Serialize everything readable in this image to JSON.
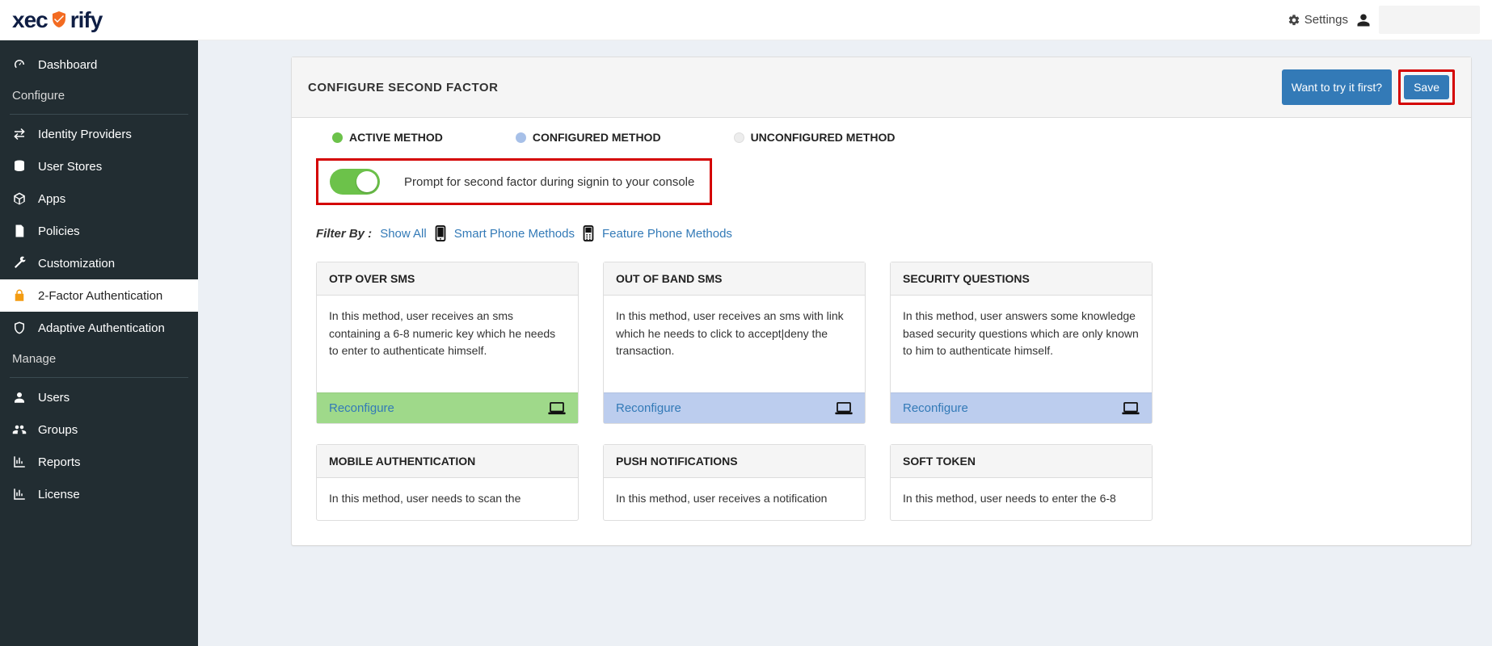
{
  "header": {
    "brand_pre": "xec",
    "brand_post": "rify",
    "settings_label": "Settings"
  },
  "sidebar": {
    "items": [
      {
        "label": "Dashboard"
      },
      {
        "section": "Configure"
      },
      {
        "label": "Identity Providers"
      },
      {
        "label": "User Stores"
      },
      {
        "label": "Apps"
      },
      {
        "label": "Policies"
      },
      {
        "label": "Customization"
      },
      {
        "label": "2-Factor Authentication",
        "active": true
      },
      {
        "label": "Adaptive Authentication"
      },
      {
        "section": "Manage"
      },
      {
        "label": "Users"
      },
      {
        "label": "Groups"
      },
      {
        "label": "Reports"
      },
      {
        "label": "License"
      }
    ]
  },
  "main": {
    "title": "CONFIGURE SECOND FACTOR",
    "try_first": "Want to try it first?",
    "save": "Save",
    "legend": {
      "active": "ACTIVE METHOD",
      "configured": "CONFIGURED METHOD",
      "unconfigured": "UNCONFIGURED METHOD"
    },
    "prompt_toggle_label": "Prompt for second factor during signin to your console",
    "filter": {
      "label": "Filter By :",
      "all": "Show All",
      "smart": "Smart Phone Methods",
      "feature": "Feature Phone Methods"
    },
    "reconfigure_label": "Reconfigure",
    "cards": [
      {
        "title": "OTP OVER SMS",
        "desc": "In this method, user receives an sms containing a 6-8 numeric key which he needs to enter to authenticate himself.",
        "status": "green"
      },
      {
        "title": "OUT OF BAND SMS",
        "desc": "In this method, user receives an sms with link which he needs to click to accept|deny the transaction.",
        "status": "blue"
      },
      {
        "title": "SECURITY QUESTIONS",
        "desc": "In this method, user answers some knowledge based security questions which are only known to him to authenticate himself.",
        "status": "blue"
      },
      {
        "title": "MOBILE AUTHENTICATION",
        "desc": "In this method, user needs to scan the"
      },
      {
        "title": "PUSH NOTIFICATIONS",
        "desc": "In this method, user receives a notification"
      },
      {
        "title": "SOFT TOKEN",
        "desc": "In this method, user needs to enter the 6-8"
      }
    ]
  }
}
